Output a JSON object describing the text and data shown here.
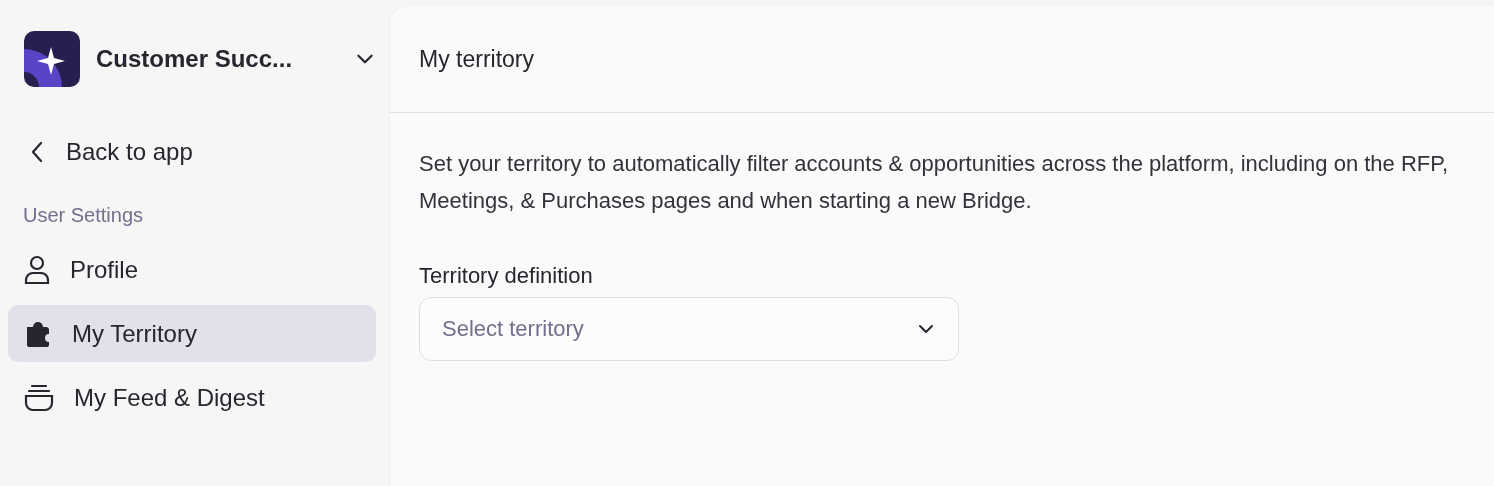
{
  "workspace": {
    "name": "Customer Succ..."
  },
  "back_link": {
    "label": "Back to app"
  },
  "sidebar": {
    "section": "User Settings",
    "items": [
      {
        "label": "Profile",
        "kind": "person",
        "selected": false
      },
      {
        "label": "My Territory",
        "kind": "puzzle",
        "selected": true
      },
      {
        "label": "My Feed & Digest",
        "kind": "stack",
        "selected": false
      }
    ]
  },
  "page": {
    "title": "My territory",
    "description": "Set your territory to automatically filter accounts & opportunities across the platform, including on the RFP, Meetings, & Purchases pages and when starting a new Bridge.",
    "field": {
      "label": "Territory definition",
      "placeholder": "Select territory"
    }
  }
}
